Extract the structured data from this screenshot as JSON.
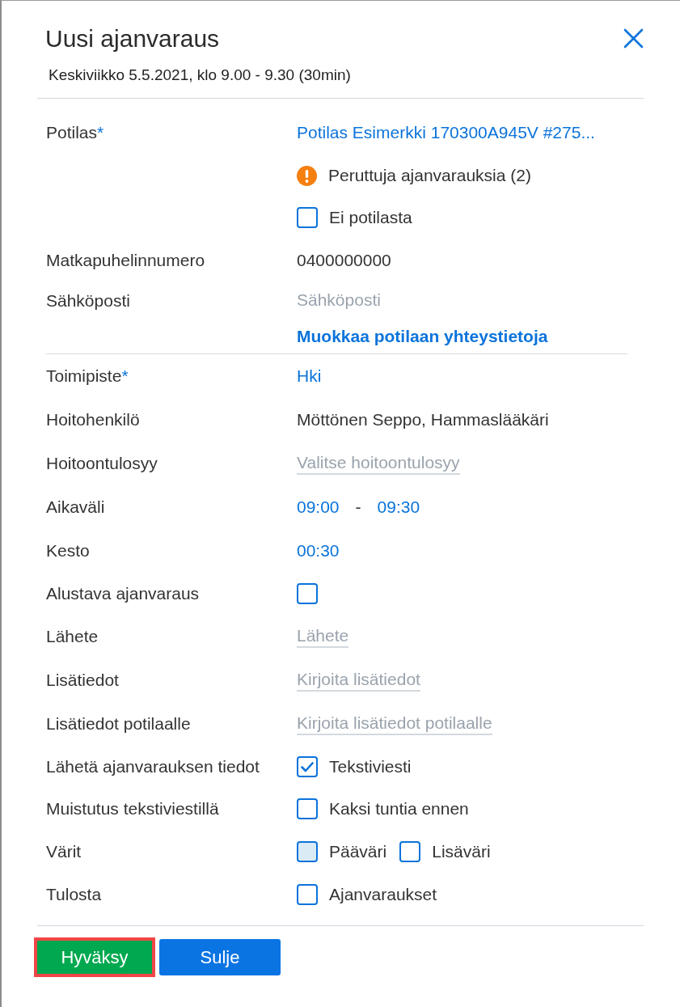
{
  "dialog": {
    "title": "Uusi ajanvaraus",
    "subtitle": "Keskiviikko 5.5.2021, klo 9.00 - 9.30 (30min)"
  },
  "sections": [
    {
      "rows": [
        {
          "kind": "link",
          "label": "Potilas",
          "required_mark": "*",
          "value": "Potilas Esimerkki 170300A945V #275..."
        },
        {
          "kind": "warning",
          "text": "Peruttuja ajanvarauksia (2)"
        },
        {
          "kind": "option",
          "options": [
            {
              "label": "Ei potilasta",
              "checked": false
            }
          ]
        },
        {
          "kind": "text",
          "label": "Matkapuhelinnumero",
          "value": "0400000000"
        },
        {
          "kind": "bare_input",
          "label": "Sähköposti",
          "placeholder": "Sähköposti"
        },
        {
          "kind": "action",
          "text": "Muokkaa potilaan yhteystietoja"
        }
      ]
    },
    {
      "rows": [
        {
          "kind": "link",
          "label": "Toimipiste",
          "required_mark": "*",
          "value": "Hki"
        },
        {
          "kind": "text",
          "label": "Hoitohenkilö",
          "value": "Möttönen Seppo, Hammaslääkäri"
        },
        {
          "kind": "input",
          "label": "Hoitoontulosyy",
          "placeholder": "Valitse hoitoontulosyy"
        },
        {
          "kind": "time_range",
          "label": "Aikaväli",
          "start": "09:00",
          "separator": "-",
          "end": "09:30"
        },
        {
          "kind": "link",
          "label": "Kesto",
          "value": "00:30"
        },
        {
          "kind": "option",
          "label": "Alustava ajanvaraus",
          "options": [
            {
              "checked": false
            }
          ]
        },
        {
          "kind": "input",
          "label": "Lähete",
          "placeholder": "Lähete"
        },
        {
          "kind": "input",
          "label": "Lisätiedot",
          "placeholder": "Kirjoita lisätiedot"
        },
        {
          "kind": "input",
          "label": "Lisätiedot potilaalle",
          "placeholder": "Kirjoita lisätiedot potilaalle"
        },
        {
          "kind": "option",
          "label": "Lähetä ajanvarauksen tiedot",
          "options": [
            {
              "label": "Tekstiviesti",
              "checked": true
            }
          ]
        },
        {
          "kind": "option",
          "label": "Muistutus tekstiviestillä",
          "options": [
            {
              "label": "Kaksi tuntia ennen",
              "checked": false
            }
          ]
        },
        {
          "kind": "swatches",
          "label": "Värit",
          "options": [
            {
              "label": "Pääväri",
              "color": "#dbebf5"
            },
            {
              "label": "Lisäväri",
              "color": "#ffffff"
            }
          ]
        },
        {
          "kind": "option",
          "label": "Tulosta",
          "options": [
            {
              "label": "Ajanvaraukset",
              "checked": false
            }
          ]
        }
      ]
    }
  ],
  "footer": {
    "buttons": [
      {
        "kind": "confirm",
        "label": "Hyväksy",
        "highlighted": true
      },
      {
        "kind": "secondary",
        "label": "Sulje",
        "highlighted": false
      }
    ]
  }
}
